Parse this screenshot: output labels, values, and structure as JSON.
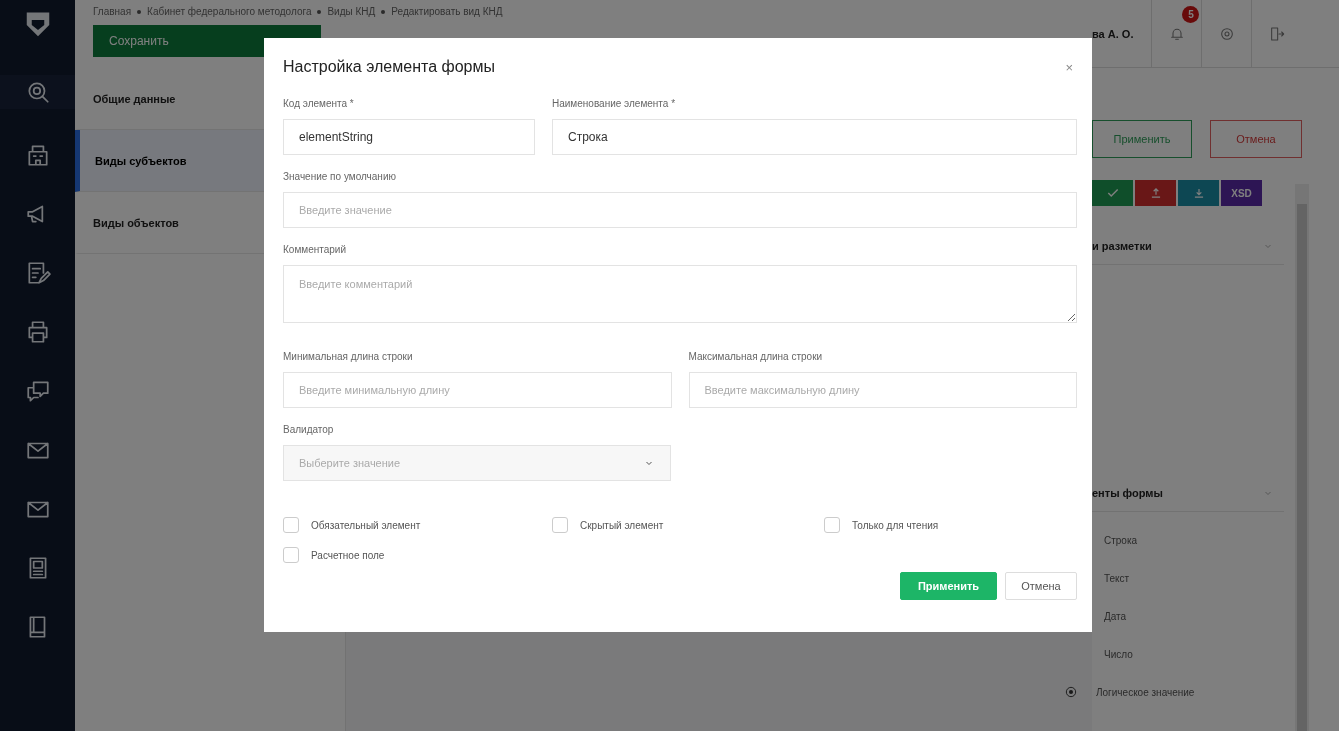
{
  "breadcrumb": [
    "Главная",
    "Кабинет федерального методолога",
    "Виды КНД",
    "Редактировать вид КНД"
  ],
  "save_button": "Сохранить",
  "nav": [
    {
      "label": "Общие данные",
      "selected": false
    },
    {
      "label": "Виды субъектов",
      "selected": true
    },
    {
      "label": "Виды объектов",
      "selected": false
    }
  ],
  "user": {
    "name": "ва А. О.",
    "notifications": "5"
  },
  "actions": {
    "apply": "Применить",
    "cancel": "Отмена"
  },
  "toolbar": [
    {
      "kind": "check"
    },
    {
      "kind": "upload"
    },
    {
      "kind": "download"
    },
    {
      "kind": "text",
      "label": "XSD"
    }
  ],
  "sections": [
    {
      "title": "и разметки"
    },
    {
      "title": "енты формы"
    }
  ],
  "elements": [
    {
      "kind": "plain",
      "label": "Строка"
    },
    {
      "kind": "plain",
      "label": "Текст"
    },
    {
      "kind": "plain",
      "label": "Дата"
    },
    {
      "kind": "plain",
      "label": "Число"
    },
    {
      "kind": "radio",
      "label": "Логическое значение"
    }
  ],
  "modal": {
    "title": "Настройка элемента формы",
    "close": "×",
    "rows": [
      {
        "fields": [
          {
            "kind": "input",
            "label": "Код элемента *",
            "value": "elementString"
          },
          {
            "kind": "input",
            "label": "Наименование элемента *",
            "value": "Строка"
          }
        ]
      },
      {
        "fields": [
          {
            "kind": "input",
            "label": "Значение по умолчанию",
            "placeholder": "Введите значение"
          }
        ]
      },
      {
        "fields": [
          {
            "kind": "textarea",
            "label": "Комментарий",
            "placeholder": "Введите комментарий"
          }
        ]
      },
      {
        "fields": [
          {
            "kind": "input",
            "label": "Минимальная длина строки",
            "placeholder": "Введите минимальную длину"
          },
          {
            "kind": "input",
            "label": "Максимальная длина строки",
            "placeholder": "Введите максимальную длину"
          }
        ]
      },
      {
        "fields": [
          {
            "kind": "select",
            "label": "Валидатор",
            "placeholder": "Выберите значение"
          }
        ]
      }
    ],
    "checkboxes": [
      {
        "label": "Обязательный элемент",
        "checked": false
      },
      {
        "label": "Скрытый элемент",
        "checked": false
      },
      {
        "label": "Только для чтения",
        "checked": false
      },
      {
        "label": "Расчетное поле",
        "checked": false
      }
    ],
    "apply": "Применить",
    "cancel": "Отмена"
  }
}
